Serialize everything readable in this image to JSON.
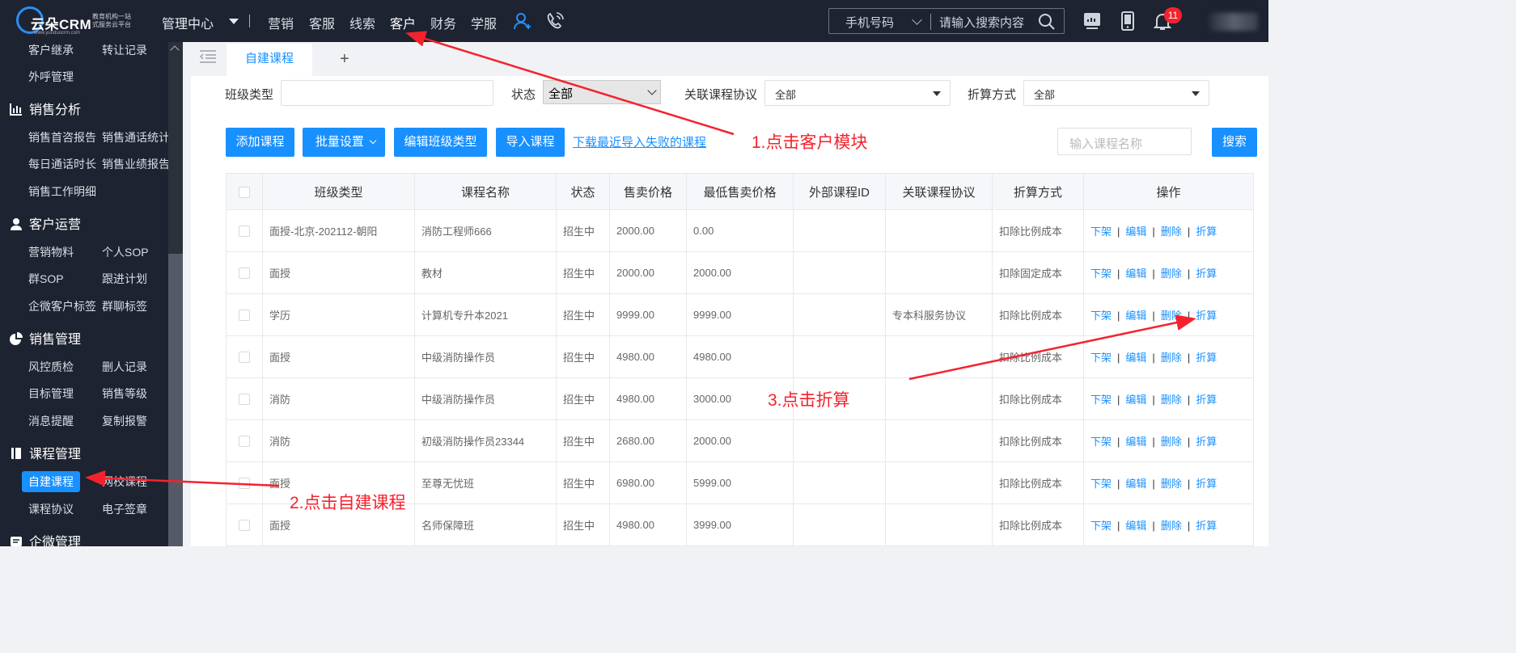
{
  "header": {
    "brand": "云朵CRM",
    "tagline_line1": "教育机构一站",
    "tagline_line2": "式服务云平台",
    "url": "www.yunduocrm.com",
    "manager_label": "管理中心",
    "nav": [
      "营销",
      "客服",
      "线索",
      "客户",
      "财务",
      "学服"
    ],
    "active_nav": "客户",
    "search_type": "手机号码",
    "search_placeholder": "请输入搜索内容",
    "notification_count": "11"
  },
  "sidebar": {
    "rows": [
      {
        "left": "客户继承",
        "right": "转让记录"
      },
      {
        "left": "外呼管理",
        "right": ""
      }
    ],
    "groups": [
      {
        "title": "销售分析",
        "items": [
          [
            "销售首咨报告",
            "销售通话统计"
          ],
          [
            "每日通话时长",
            "销售业绩报告"
          ],
          [
            "销售工作明细",
            ""
          ]
        ]
      },
      {
        "title": "客户运营",
        "items": [
          [
            "营销物料",
            "个人SOP"
          ],
          [
            "群SOP",
            "跟进计划"
          ],
          [
            "企微客户标签",
            "群聊标签"
          ]
        ]
      },
      {
        "title": "销售管理",
        "items": [
          [
            "风控质检",
            "删人记录"
          ],
          [
            "目标管理",
            "销售等级"
          ],
          [
            "消息提醒",
            "复制报警"
          ]
        ]
      },
      {
        "title": "课程管理",
        "items": [
          [
            "自建课程",
            "网校课程"
          ],
          [
            "课程协议",
            "电子签章"
          ]
        ]
      },
      {
        "title": "企微管理",
        "items": []
      }
    ],
    "active_item": "自建课程"
  },
  "tabs": {
    "active": "自建课程",
    "add": "+"
  },
  "filters": {
    "class_type_label": "班级类型",
    "class_type_value": "",
    "status_label": "状态",
    "status_value": "全部",
    "agreement_label": "关联课程协议",
    "agreement_value": "全部",
    "discount_label": "折算方式",
    "discount_value": "全部"
  },
  "actions": {
    "add": "添加课程",
    "batch": "批量设置",
    "edit_class": "编辑班级类型",
    "import": "导入课程",
    "download_link": "下载最近导入失败的课程",
    "course_search_placeholder": "输入课程名称",
    "search": "搜索"
  },
  "table": {
    "columns": [
      "班级类型",
      "课程名称",
      "状态",
      "售卖价格",
      "最低售卖价格",
      "外部课程ID",
      "关联课程协议",
      "折算方式",
      "操作"
    ],
    "rows": [
      {
        "class_type": "面授-北京-202112-朝阳",
        "name": "消防工程师666",
        "status": "招生中",
        "price": "2000.00",
        "min_price": "0.00",
        "ext_id": "",
        "agreement": "",
        "discount": "扣除比例成本"
      },
      {
        "class_type": "面授",
        "name": "教材",
        "status": "招生中",
        "price": "2000.00",
        "min_price": "2000.00",
        "ext_id": "",
        "agreement": "",
        "discount": "扣除固定成本"
      },
      {
        "class_type": "学历",
        "name": "计算机专升本2021",
        "status": "招生中",
        "price": "9999.00",
        "min_price": "9999.00",
        "ext_id": "",
        "agreement": "专本科服务协议",
        "discount": "扣除比例成本"
      },
      {
        "class_type": "面授",
        "name": "中级消防操作员",
        "status": "招生中",
        "price": "4980.00",
        "min_price": "4980.00",
        "ext_id": "",
        "agreement": "",
        "discount": "扣除比例成本"
      },
      {
        "class_type": "消防",
        "name": "中级消防操作员",
        "status": "招生中",
        "price": "4980.00",
        "min_price": "3000.00",
        "ext_id": "",
        "agreement": "",
        "discount": "扣除比例成本"
      },
      {
        "class_type": "消防",
        "name": "初级消防操作员23344",
        "status": "招生中",
        "price": "2680.00",
        "min_price": "2000.00",
        "ext_id": "",
        "agreement": "",
        "discount": "扣除比例成本"
      },
      {
        "class_type": "面授",
        "name": "至尊无忧班",
        "status": "招生中",
        "price": "6980.00",
        "min_price": "5999.00",
        "ext_id": "",
        "agreement": "",
        "discount": "扣除比例成本"
      },
      {
        "class_type": "面授",
        "name": "名师保障班",
        "status": "招生中",
        "price": "4980.00",
        "min_price": "3999.00",
        "ext_id": "",
        "agreement": "",
        "discount": "扣除比例成本"
      }
    ],
    "ops": [
      "下架",
      "编辑",
      "删除",
      "折算"
    ]
  },
  "annotations": {
    "step1": "1.点击客户模块",
    "step2": "2.点击自建课程",
    "step3": "3.点击折算",
    "color": "#f5222d"
  },
  "colors": {
    "primary": "#1890ff",
    "sidebar_bg": "#1d2330",
    "header_bg": "#1d2330"
  }
}
